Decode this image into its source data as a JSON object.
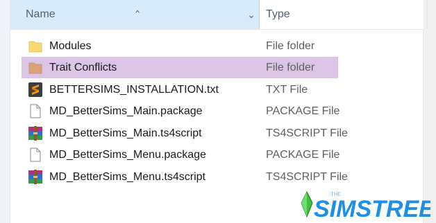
{
  "header": {
    "name_label": "Name",
    "type_label": "Type",
    "sort_icon": "chevron-up-icon",
    "dropdown_icon": "chevron-down-icon"
  },
  "files": [
    {
      "name": "Modules",
      "type": "File folder",
      "icon": "folder-icon",
      "selected": false
    },
    {
      "name": "Trait Conflicts",
      "type": "File folder",
      "icon": "folder-icon",
      "selected": true
    },
    {
      "name": "BETTERSIMS_INSTALLATION.txt",
      "type": "TXT File",
      "icon": "sublime-text-icon",
      "selected": false
    },
    {
      "name": "MD_BetterSims_Main.package",
      "type": "PACKAGE File",
      "icon": "document-icon",
      "selected": false
    },
    {
      "name": "MD_BetterSims_Main.ts4script",
      "type": "TS4SCRIPT File",
      "icon": "winrar-archive-icon",
      "selected": false
    },
    {
      "name": "MD_BetterSims_Menu.package",
      "type": "PACKAGE File",
      "icon": "document-icon",
      "selected": false
    },
    {
      "name": "MD_BetterSims_Menu.ts4script",
      "type": "TS4SCRIPT File",
      "icon": "winrar-archive-icon",
      "selected": false
    }
  ],
  "watermark": {
    "text": "THE SIMSTREE",
    "icon": "plumbob-icon"
  },
  "colors": {
    "header_active_bg": "#d9ebf9",
    "selection_bg": "#dcc4e6",
    "folder": "#f8d775",
    "logo_blue": "#1e8fe6",
    "plumbob_green": "#3fbf3f"
  }
}
